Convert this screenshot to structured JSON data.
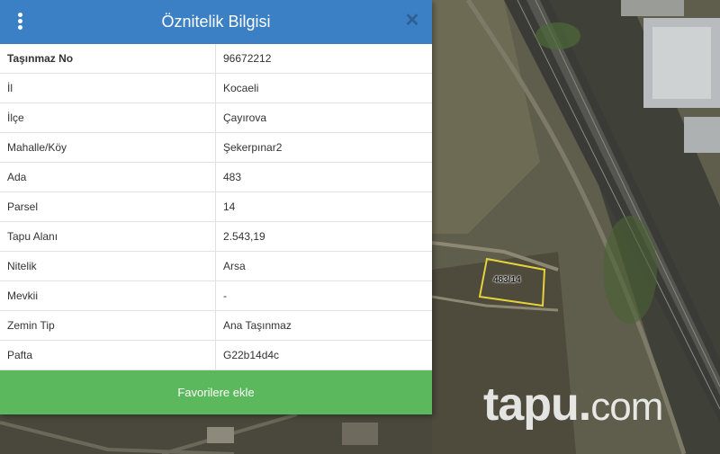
{
  "panel": {
    "title": "Öznitelik Bilgisi",
    "close_glyph": "✕",
    "rows": [
      {
        "key": "Taşınmaz No",
        "value": "96672212"
      },
      {
        "key": "İl",
        "value": "Kocaeli"
      },
      {
        "key": "İlçe",
        "value": "Çayırova"
      },
      {
        "key": "Mahalle/Köy",
        "value": "Şekerpınar2"
      },
      {
        "key": "Ada",
        "value": "483"
      },
      {
        "key": "Parsel",
        "value": "14"
      },
      {
        "key": "Tapu Alanı",
        "value": "2.543,19"
      },
      {
        "key": "Nitelik",
        "value": "Arsa"
      },
      {
        "key": "Mevkii",
        "value": "-"
      },
      {
        "key": "Zemin Tip",
        "value": "Ana Taşınmaz"
      },
      {
        "key": "Pafta",
        "value": "G22b14d4c"
      }
    ],
    "favorite_button": "Favorilere ekle"
  },
  "map": {
    "parcel_label": "483/14",
    "watermark": {
      "brand": "tapu",
      "dot": ".",
      "tld": "com"
    }
  },
  "colors": {
    "header": "#3b7fc4",
    "button": "#5cb85c",
    "parcel_outline": "#e8d23a"
  }
}
